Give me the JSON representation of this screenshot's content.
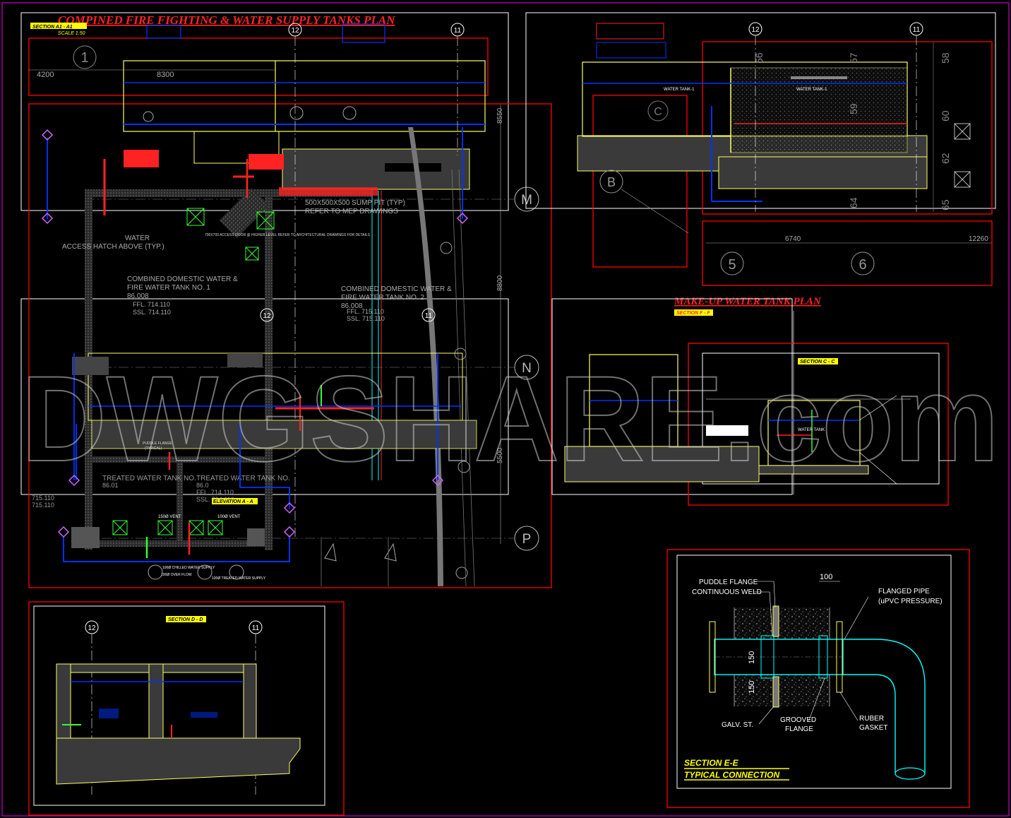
{
  "drawing": {
    "title_main": "COMPINED FIRE FIGHTING & WATER SUPPLY TANKS PLAN",
    "title_makeup": "MAKE-UP WATER TANK PLAN",
    "watermark": "DWGSHARE.com",
    "colors": {
      "background": "#000000",
      "frame": "#ff0000",
      "outer_frame": "#cc00cc",
      "panel": "#ffffff",
      "wall": "#ffff66",
      "pipe_blue": "#0033ff",
      "pipe_cyan": "#00ffff",
      "pipe_red": "#ff2222",
      "pipe_green": "#33ff33",
      "grid": "#d9d9d9",
      "fill": "#3a3a3a"
    }
  },
  "tags": {
    "section_a1": "SECTION A1 - A1",
    "scale": "SCALE 1:50",
    "section_f": "SECTION F - F",
    "section_c": "SECTION C - C",
    "section_d": "SECTION D - D",
    "elevation_a": "ELEVATION A - A"
  },
  "grid": {
    "g12": "12",
    "g11": "11",
    "g1": "1",
    "gM": "M",
    "gN": "N",
    "gP": "P",
    "gB": "B",
    "g5": "5",
    "g6": "6",
    "gC": "C"
  },
  "dims": {
    "d4200": "4200",
    "d8300": "8300",
    "d8550": "8550",
    "d8800": "8800",
    "d5500": "5500",
    "d6740": "6740",
    "d12260": "12260",
    "d56": "56",
    "d57": "57",
    "d58": "58",
    "d60": "60",
    "d62": "62",
    "d64": "64",
    "d65": "65",
    "d59": "59",
    "d100": "100",
    "d150a": "150",
    "d150b": "150"
  },
  "plan_labels": {
    "sump": "500X500X500 SUMP PIT (TYP)",
    "sump2": "REFER TO MEP DRAWINGS",
    "access": "ACCESS HATCH ABOVE (TYP.)",
    "water": "WATER",
    "tank1_a": "COMBINED DOMESTIC WATER &",
    "tank1_b": "FIRE WATER TANK NO. 1",
    "tank1_c": "86.008",
    "tank1_d": "FFL. 714.110",
    "tank1_e": "SSL. 714.110",
    "tank2_a": "COMBINED DOMESTIC WATER &",
    "tank2_b": "FIRE WATER TANK NO. 2",
    "tank2_c": "86.008",
    "tank2_d": "FFL. 715.110",
    "tank2_e": "SSL. 715.110",
    "treated1": "TREATED WATER TANK NO.",
    "treated2": "TREATED WATER TANK NO.",
    "treated_ffl": "FFL. 714.110",
    "treated_ssl": "SSL. 714.110",
    "treated_lvl1": "86.01",
    "treated_lvl2": "86.0",
    "lvl_a": "715.110",
    "lvl_b": "715.110",
    "puddle": "PUDDLE FLANGE",
    "puddle_b": "(TYPICAL)",
    "vent150a": "150Ø VENT",
    "vent100": "100Ø VENT",
    "overflow": "100Ø OVER FLOW",
    "supply100": "100Ø SUPPLY",
    "chilled": "100Ø CHILLED WATER SUPPLY",
    "treated_supply": "100Ø TREATED WATER SUPPLY",
    "ovf_plan": "100Ø OVER FLOW",
    "hatch_note": "700X700 ACCESS DOOR @ HIGHER LEVEL REFER TO ARCHITECTURAL DRAWINGS FOR DETAILS",
    "water_tank1": "WATER TANK-1",
    "water_tank2": "WATER TANK-2",
    "water_tank_label": "WATER TANK",
    "tank_label_right": "WATER TANK-1"
  },
  "detail_e": {
    "puddle_flange": "PUDDLE FLANGE",
    "continuous_weld": "CONTINUOUS WELD",
    "flanged_pipe": "FLANGED PIPE",
    "upvc": "(uPVC PRESSURE)",
    "galv": "GALV. ST.",
    "grooved": "GROOVED",
    "flange": "FLANGE",
    "ruber": "RUBER",
    "gasket": "GASKET",
    "title": "SECTION E-E",
    "subtitle": "TYPICAL CONNECTION"
  }
}
